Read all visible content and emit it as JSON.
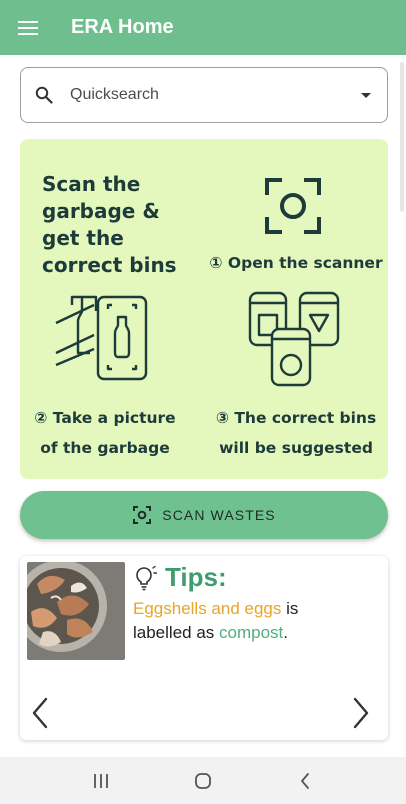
{
  "appbar": {
    "title": "ERA Home",
    "menu_icon": "hamburger-menu-icon",
    "color": "#6fbf8e"
  },
  "search": {
    "placeholder": "Quicksearch",
    "icon": "search-icon"
  },
  "hero": {
    "title": "Scan the garbage & get the correct bins",
    "step1": "① Open the scanner",
    "step2": [
      "② Take a picture",
      "of the garbage"
    ],
    "step3": [
      "③ The correct bins",
      "will be suggested"
    ],
    "background": "#e4f7bd"
  },
  "scan_button": {
    "label": "SCAN WASTES",
    "icon": "scan-icon"
  },
  "tips": {
    "title": "Tips:",
    "highlight_item": "Eggshells and eggs",
    "text_is": "is",
    "text_labelled": "labelled as",
    "highlight_category": "compost",
    "end": ".",
    "image_alt": "eggshells",
    "prev_icon": "chevron-left-icon",
    "next_icon": "chevron-right-icon",
    "colors": {
      "item": "#e6a628",
      "category": "#4fb07d",
      "title": "#3e9c6f"
    }
  },
  "system_nav": {
    "recents": "recents-icon",
    "home": "home-icon",
    "back": "back-icon"
  }
}
